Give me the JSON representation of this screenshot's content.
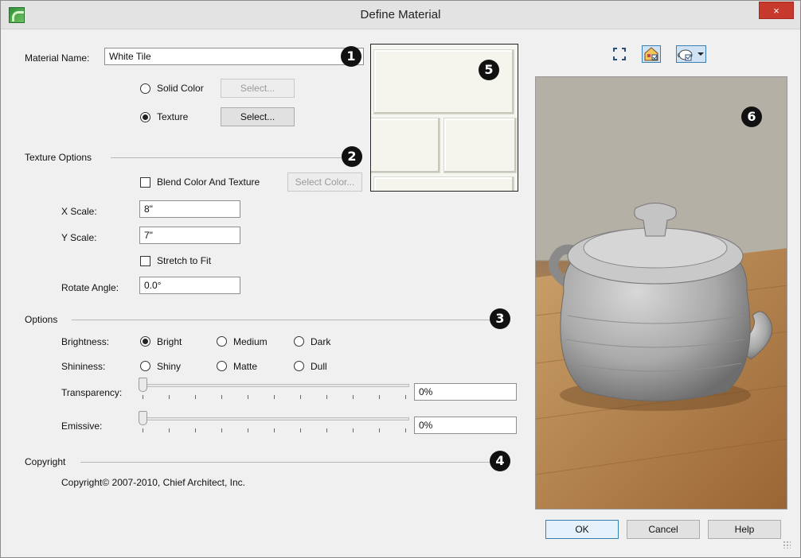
{
  "window": {
    "title": "Define Material",
    "close_label": "×"
  },
  "material": {
    "name_label": "Material Name:",
    "name_value": "White Tile",
    "solid_color_label": "Solid Color",
    "solid_color_select": "Select...",
    "texture_label": "Texture",
    "texture_select": "Select..."
  },
  "texture_options": {
    "heading": "Texture Options",
    "blend_label": "Blend Color And Texture",
    "select_color": "Select Color...",
    "x_scale_label": "X Scale:",
    "x_scale_value": "8\"",
    "y_scale_label": "Y Scale:",
    "y_scale_value": "7\"",
    "stretch_label": "Stretch to Fit",
    "rotate_label": "Rotate Angle:",
    "rotate_value": "0.0°"
  },
  "options": {
    "heading": "Options",
    "brightness_label": "Brightness:",
    "brightness": [
      "Bright",
      "Medium",
      "Dark"
    ],
    "brightness_selected": "Bright",
    "shininess_label": "Shininess:",
    "shininess": [
      "Shiny",
      "Matte",
      "Dull"
    ],
    "transparency_label": "Transparency:",
    "transparency_value": "0%",
    "transparency_level": 0,
    "emissive_label": "Emissive:",
    "emissive_value": "0%",
    "emissive_level": 0
  },
  "copyright": {
    "heading": "Copyright",
    "text": "Copyright© 2007-2010, Chief Architect, Inc."
  },
  "markers": [
    "1",
    "2",
    "3",
    "4",
    "5",
    "6"
  ],
  "toolbar": {
    "icons": [
      "fit-to-window-icon",
      "house-materials-icon",
      "teapot-preview-icon"
    ]
  },
  "buttons": {
    "ok": "OK",
    "cancel": "Cancel",
    "help": "Help"
  }
}
